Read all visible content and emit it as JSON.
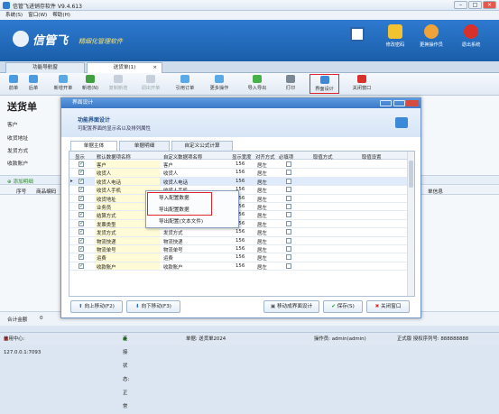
{
  "window": {
    "title": "信管飞进销存软件 V9.4.613"
  },
  "menu": [
    "系统(S)",
    "窗口(W)",
    "帮助(H)"
  ],
  "banner": {
    "brand": "信管飞",
    "slogan": "精细化管理软件",
    "buttons": [
      "修改密码",
      "更换操作员",
      "退出系统"
    ]
  },
  "tabs": [
    "功能导航窗",
    "送货单(1)"
  ],
  "toolbar": [
    "前单",
    "后单",
    "新增开单",
    "新增(N)",
    "复制新增",
    "调出开单",
    "引用订单",
    "更多操作",
    "导入导出",
    "打印",
    "界面设计",
    "关闭窗口"
  ],
  "doc": {
    "title": "送货单",
    "labels": [
      "客户",
      "收货地址",
      "发货方式",
      "收款账户"
    ],
    "add_detail": "添加明细",
    "grid_headers": [
      "序号",
      "商品编码"
    ],
    "right_header": "单信息",
    "total_label": "合计金额",
    "total_value": "0"
  },
  "status": {
    "center": "信用中心: 127.0.0.1:7093",
    "conn": "连接状态: 正常",
    "form": "单据: 送货单2024",
    "operator": "操作员: admin(admin)",
    "edition": "正式版 授权序列号: 888888888"
  },
  "dialog": {
    "title": "界面设计",
    "head_title": "功能界面设计",
    "head_sub": "可配置界面的显示名以及排列属性",
    "tabs": [
      "单据主体",
      "单据明细",
      "自定义公式计算"
    ],
    "columns": [
      "显示",
      "默认数据项名称",
      "自定义数据项名称",
      "显示宽度",
      "对齐方式",
      "必填项",
      "取值方式",
      "取值设置"
    ],
    "rows": [
      {
        "on": true,
        "name": "客户",
        "custom": "客户",
        "width": "156",
        "align": "居左"
      },
      {
        "on": true,
        "name": "收货人",
        "custom": "收货人",
        "width": "156",
        "align": "居左"
      },
      {
        "on": true,
        "name": "收货人电话",
        "custom": "收货人电话",
        "width": "156",
        "align": "居左"
      },
      {
        "on": true,
        "name": "收货人手机",
        "custom": "收货人手机",
        "width": "156",
        "align": "居左"
      },
      {
        "on": true,
        "name": "收货地址",
        "custom": "收货地址",
        "width": "156",
        "align": "居左"
      },
      {
        "on": true,
        "name": "业务员",
        "custom": "业务员",
        "width": "156",
        "align": "居左"
      },
      {
        "on": true,
        "name": "结算方式",
        "custom": "结算方式",
        "width": "156",
        "align": "居左"
      },
      {
        "on": true,
        "name": "发票类型",
        "custom": "发票类型",
        "width": "156",
        "align": "居左"
      },
      {
        "on": true,
        "name": "发货方式",
        "custom": "发货方式",
        "width": "156",
        "align": "居左"
      },
      {
        "on": true,
        "name": "物流快递",
        "custom": "物流快递",
        "width": "156",
        "align": "居左"
      },
      {
        "on": true,
        "name": "物流单号",
        "custom": "物流单号",
        "width": "156",
        "align": "居左"
      },
      {
        "on": true,
        "name": "运费",
        "custom": "运费",
        "width": "156",
        "align": "居左"
      },
      {
        "on": true,
        "name": "收款账户",
        "custom": "收款账户",
        "width": "156",
        "align": "居左"
      }
    ],
    "context_menu": [
      "导入配置数据",
      "导出配置数据",
      "导出配置(文本文件)"
    ],
    "buttons": [
      "向上移动(F2)",
      "向下移动(F3)",
      "移动成界面设计",
      "保存(S)",
      "关闭窗口"
    ]
  }
}
